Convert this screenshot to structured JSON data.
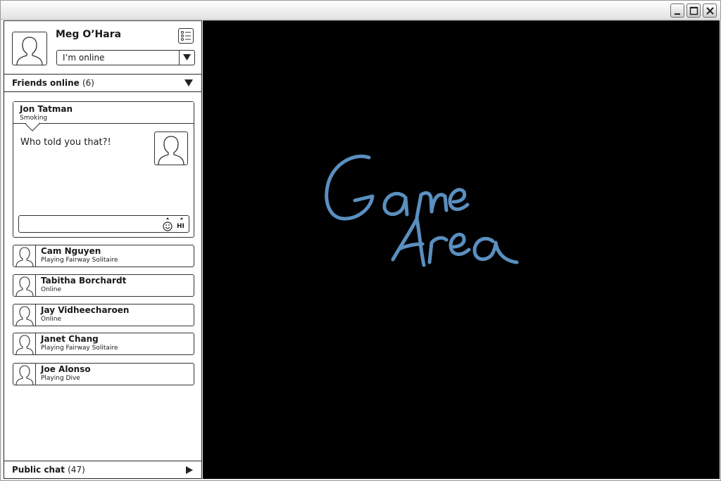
{
  "window": {
    "buttons": [
      "minimize-icon",
      "maximize-icon",
      "close-icon"
    ]
  },
  "profile": {
    "name": "Meg O’Hara",
    "status": "I’m online"
  },
  "friends_online": {
    "label": "Friends online",
    "count": "(6)"
  },
  "chat": {
    "name": "Jon Tatman",
    "status": "Smoking",
    "message": "Who told you that?!",
    "nudge_label": "HI"
  },
  "friends": [
    {
      "name": "Cam Nguyen",
      "status": "Playing Fairway Solitaire"
    },
    {
      "name": "Tabitha Borchardt",
      "status": "Online"
    },
    {
      "name": "Jay Vidheecharoen",
      "status": "Online"
    },
    {
      "name": "Janet Chang",
      "status": "Playing Fairway Solitaire"
    },
    {
      "name": "Joe Alonso",
      "status": "Playing Dive"
    }
  ],
  "public_chat": {
    "label": "Public chat",
    "count": "(47)"
  },
  "game": {
    "line1": "Game",
    "line2": "Area",
    "ink_color": "#5a8fc0"
  }
}
